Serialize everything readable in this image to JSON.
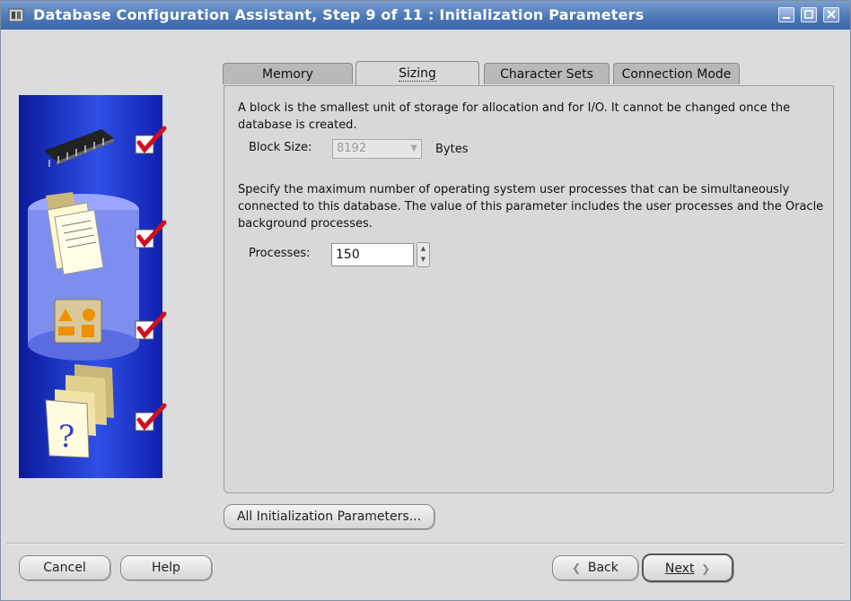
{
  "window": {
    "title": "Database Configuration Assistant, Step 9 of 11 : Initialization Parameters"
  },
  "tabs": [
    {
      "label": "Memory",
      "active": false
    },
    {
      "label": "Sizing",
      "active": true
    },
    {
      "label": "Character Sets",
      "active": false
    },
    {
      "label": "Connection Mode",
      "active": false
    }
  ],
  "sizing": {
    "block_description": "A block is the smallest unit of storage for allocation and for I/O. It cannot be changed once the database is created.",
    "block_size_label": "Block Size:",
    "block_size_value": "8192",
    "block_size_unit": "Bytes",
    "processes_description": "Specify the maximum number of operating system user processes that can be simultaneously connected to this database. The value of this parameter includes the user processes and the Oracle background processes.",
    "processes_label": "Processes:",
    "processes_value": "150"
  },
  "buttons": {
    "all_params": "All Initialization Parameters...",
    "cancel": "Cancel",
    "help": "Help",
    "back": "Back",
    "next": "Next"
  },
  "colors": {
    "titlebar": "#4d78b8",
    "sidebar": "#1a2fd0",
    "check": "#d01020"
  }
}
